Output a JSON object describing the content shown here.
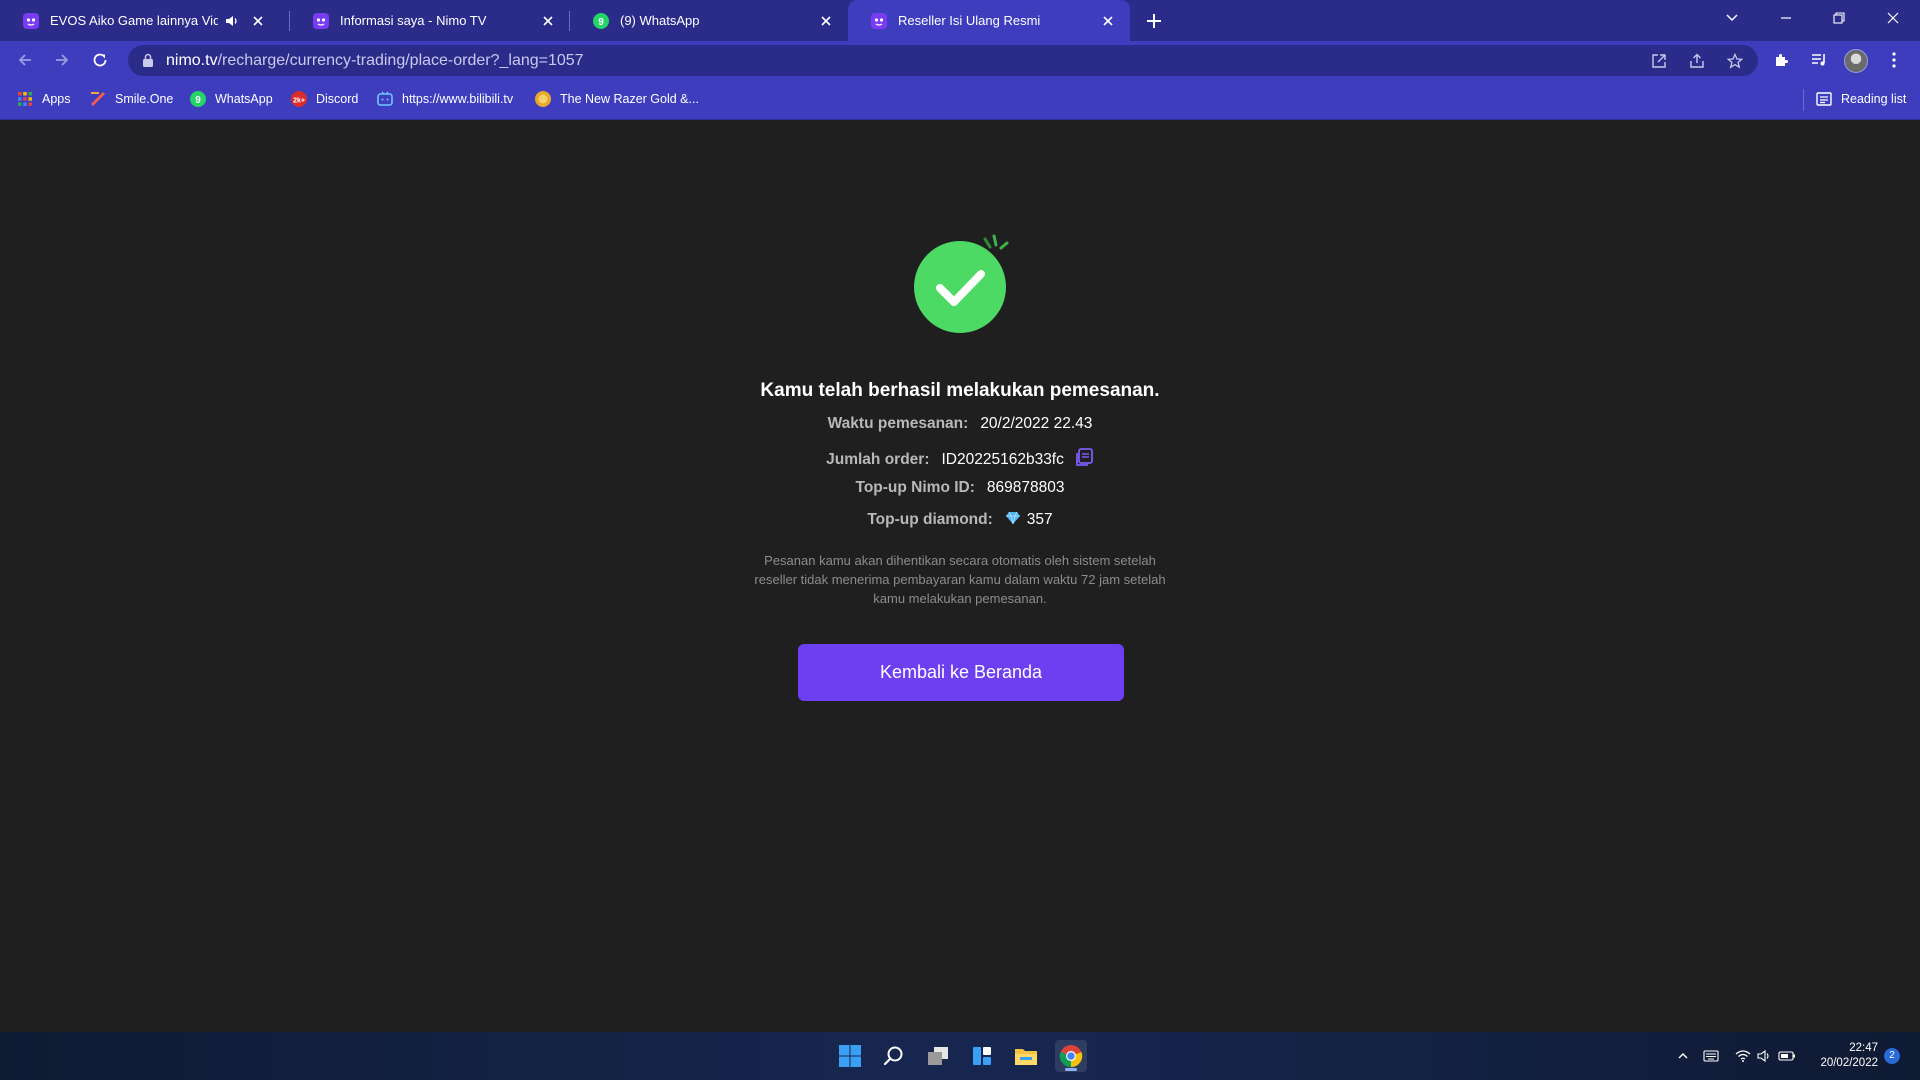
{
  "tabs": [
    {
      "title": "EVOS Aiko Game lainnya Video Str",
      "favicon": "nimo-favicon",
      "audio": true
    },
    {
      "title": "Informasi saya - Nimo TV",
      "favicon": "nimo-favicon"
    },
    {
      "title": "(9) WhatsApp",
      "favicon": "whatsapp-favicon"
    },
    {
      "title": "Reseller Isi Ulang Resmi",
      "favicon": "nimo-favicon",
      "active": true
    }
  ],
  "address": {
    "host": "nimo.tv",
    "path": "/recharge/currency-trading/place-order?_lang=1057"
  },
  "bookmarks": [
    {
      "label": "Apps",
      "icon": "apps-grid-icon"
    },
    {
      "label": "Smile.One",
      "icon": "smileone-icon"
    },
    {
      "label": "WhatsApp",
      "icon": "whatsapp-icon"
    },
    {
      "label": "Discord",
      "icon": "discord-icon"
    },
    {
      "label": "https://www.bilibili.tv",
      "icon": "bilibili-icon"
    },
    {
      "label": "The New Razer Gold &...",
      "icon": "razer-gold-icon"
    }
  ],
  "reading_list": "Reading list",
  "order": {
    "heading": "Kamu telah berhasil melakukan pemesanan.",
    "time_label": "Waktu pemesanan:",
    "time_value": "20/2/2022 22.43",
    "order_label": "Jumlah order:",
    "order_value": "ID20225162b33fc",
    "nimo_id_label": "Top-up Nimo ID:",
    "nimo_id_value": "869878803",
    "diamond_label": "Top-up diamond:",
    "diamond_value": "357",
    "notice": "Pesanan kamu akan dihentikan secara otomatis oleh sistem setelah reseller tidak menerima pembayaran kamu dalam waktu 72 jam setelah kamu melakukan pemesanan.",
    "home_button": "Kembali ke Beranda"
  },
  "colors": {
    "tab_strip": "#2b2b8a",
    "toolbar": "#3d3dbd",
    "page_bg": "#1f1f1f",
    "success": "#4cd964",
    "button": "#6d3ff0",
    "copy_icon": "#7b5cf5"
  },
  "taskbar": {
    "apps": [
      "windows-start-icon",
      "search-icon",
      "task-view-icon",
      "widgets-icon",
      "file-explorer-icon",
      "chrome-icon"
    ],
    "time": "22:47",
    "date": "20/02/2022",
    "notifications": "2"
  }
}
